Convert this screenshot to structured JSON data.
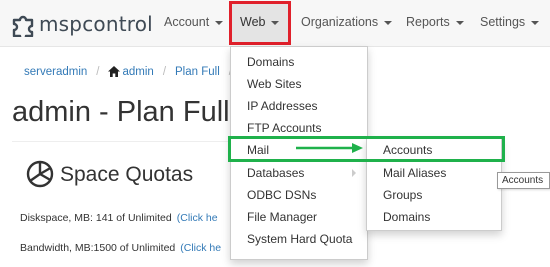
{
  "brand": {
    "name": "mspcontrol",
    "logo_icon": "puzzle-logo-icon"
  },
  "navbar": {
    "items": [
      {
        "label": "Account"
      },
      {
        "label": "Web"
      },
      {
        "label": "Organizations"
      },
      {
        "label": "Reports"
      },
      {
        "label": "Settings"
      }
    ]
  },
  "breadcrumb": {
    "items": [
      "serveradmin",
      "admin",
      "Plan Full"
    ]
  },
  "page": {
    "title": "admin - Plan Full"
  },
  "quotas": {
    "title": "Space Quotas",
    "rows": [
      {
        "label": "Diskspace, MB: 141 of Unlimited",
        "link": "(Click he"
      },
      {
        "label": "Bandwidth, MB:1500 of Unlimited",
        "link": "(Click he"
      }
    ]
  },
  "web_menu": {
    "items": [
      "Domains",
      "Web Sites",
      "IP Addresses",
      "FTP Accounts",
      "Mail",
      "Databases",
      "ODBC DSNs",
      "File Manager",
      "System Hard Quota"
    ]
  },
  "mail_submenu": {
    "items": [
      "Accounts",
      "Mail Aliases",
      "Groups",
      "Domains"
    ]
  },
  "tooltip": {
    "text": "Accounts"
  },
  "colors": {
    "highlight_red": "#e0202b",
    "highlight_green": "#1fb14b",
    "link_blue": "#337ab7"
  }
}
